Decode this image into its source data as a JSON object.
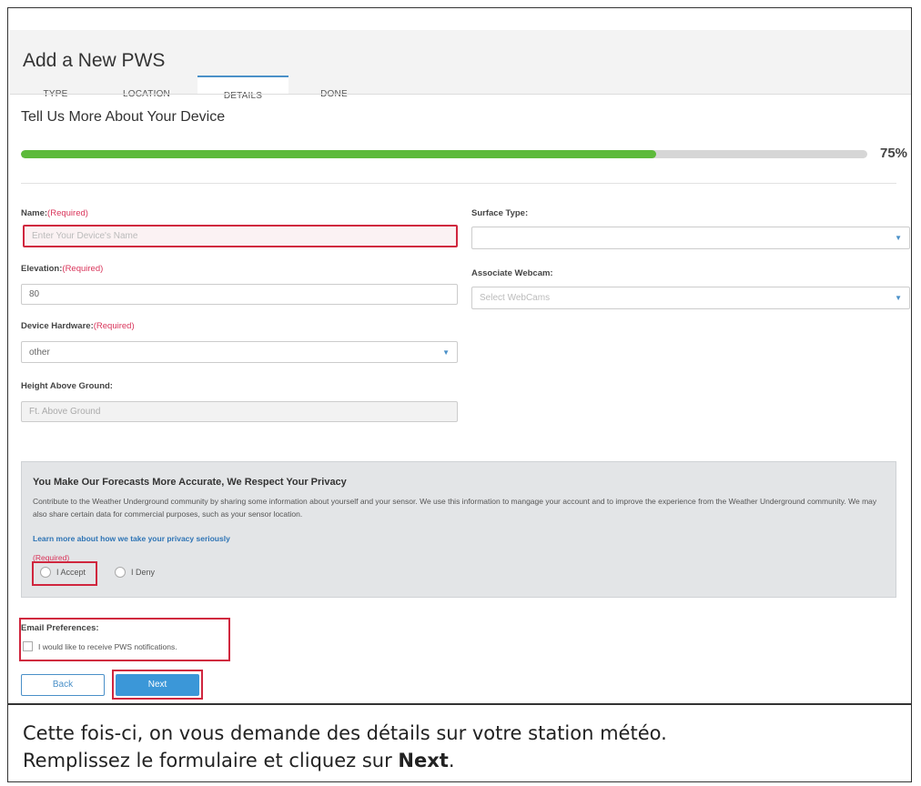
{
  "header": {
    "title": "Add a New PWS",
    "tabs": [
      {
        "label": "TYPE"
      },
      {
        "label": "LOCATION"
      },
      {
        "label": "DETAILS"
      },
      {
        "label": "DONE"
      }
    ]
  },
  "section_title": "Tell Us More About Your Device",
  "progress": {
    "percent_label": "75%",
    "fraction": 0.75
  },
  "form": {
    "required_tag": "(Required)",
    "name": {
      "label": "Name:",
      "placeholder": "Enter Your Device's Name"
    },
    "elevation": {
      "label": "Elevation:",
      "value": "80"
    },
    "hardware": {
      "label": "Device Hardware:",
      "value": "other"
    },
    "height": {
      "label": "Height Above Ground:",
      "placeholder": "Ft. Above Ground"
    },
    "surface": {
      "label": "Surface Type:",
      "value": ""
    },
    "webcam": {
      "label": "Associate Webcam:",
      "placeholder": "Select WebCams"
    }
  },
  "privacy": {
    "title": "You Make Our Forecasts More Accurate, We Respect Your Privacy",
    "text": "Contribute to the Weather Underground community by sharing some information about yourself and your sensor. We use this information to mangage your account and to improve the experience from the Weather Underground community. We may also share certain data for commercial purposes, such as your sensor location.",
    "link": "Learn more about how we take your privacy seriously",
    "required": "(Required)",
    "accept": "I Accept",
    "deny": "I Deny"
  },
  "email": {
    "label": "Email Preferences:",
    "option": "I would like to receive PWS notifications."
  },
  "buttons": {
    "back": "Back",
    "next": "Next"
  },
  "caption": {
    "line1": "Cette fois-ci, on vous demande des détails sur votre station météo.",
    "line2_prefix": "Remplissez le formulaire et cliquez sur ",
    "line2_bold": "Next",
    "line2_suffix": "."
  },
  "colors": {
    "accent": "#4a90c8",
    "progress": "#5dba3b",
    "highlight": "#d0263e",
    "required": "#d9345a"
  }
}
